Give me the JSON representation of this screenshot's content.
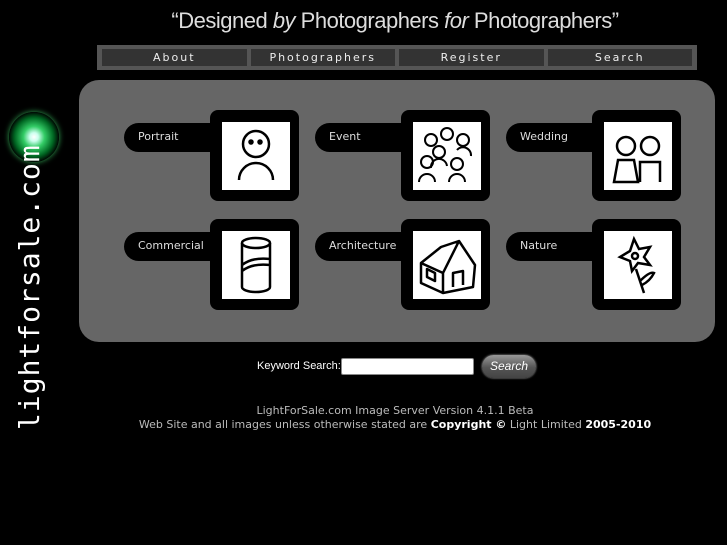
{
  "header": {
    "tagline_parts": [
      "“Designed ",
      "by",
      " Photographers ",
      "for",
      " Photographers”"
    ]
  },
  "logo": {
    "text": "lightforsale.com"
  },
  "nav": [
    "About",
    "Photographers",
    "Register",
    "Search"
  ],
  "categories": [
    {
      "label": "Portrait",
      "icon": "person-icon"
    },
    {
      "label": "Event",
      "icon": "crowd-icon"
    },
    {
      "label": "Wedding",
      "icon": "couple-icon"
    },
    {
      "label": "Commercial",
      "icon": "can-icon"
    },
    {
      "label": "Architecture",
      "icon": "house-icon"
    },
    {
      "label": "Nature",
      "icon": "flower-icon"
    }
  ],
  "search": {
    "label": "Keyword Search:",
    "value": "",
    "button": "Search"
  },
  "footer": {
    "line1": "LightForSale.com Image Server Version 4.1.1 Beta",
    "line2_pre": "Web Site and all images unless otherwise stated are ",
    "copyright": "Copyright ©",
    "line2_mid": " Light Limited ",
    "years": "2005-2010"
  },
  "colors": {
    "panel": "#666666",
    "background": "#000000",
    "nav": "#555555"
  }
}
